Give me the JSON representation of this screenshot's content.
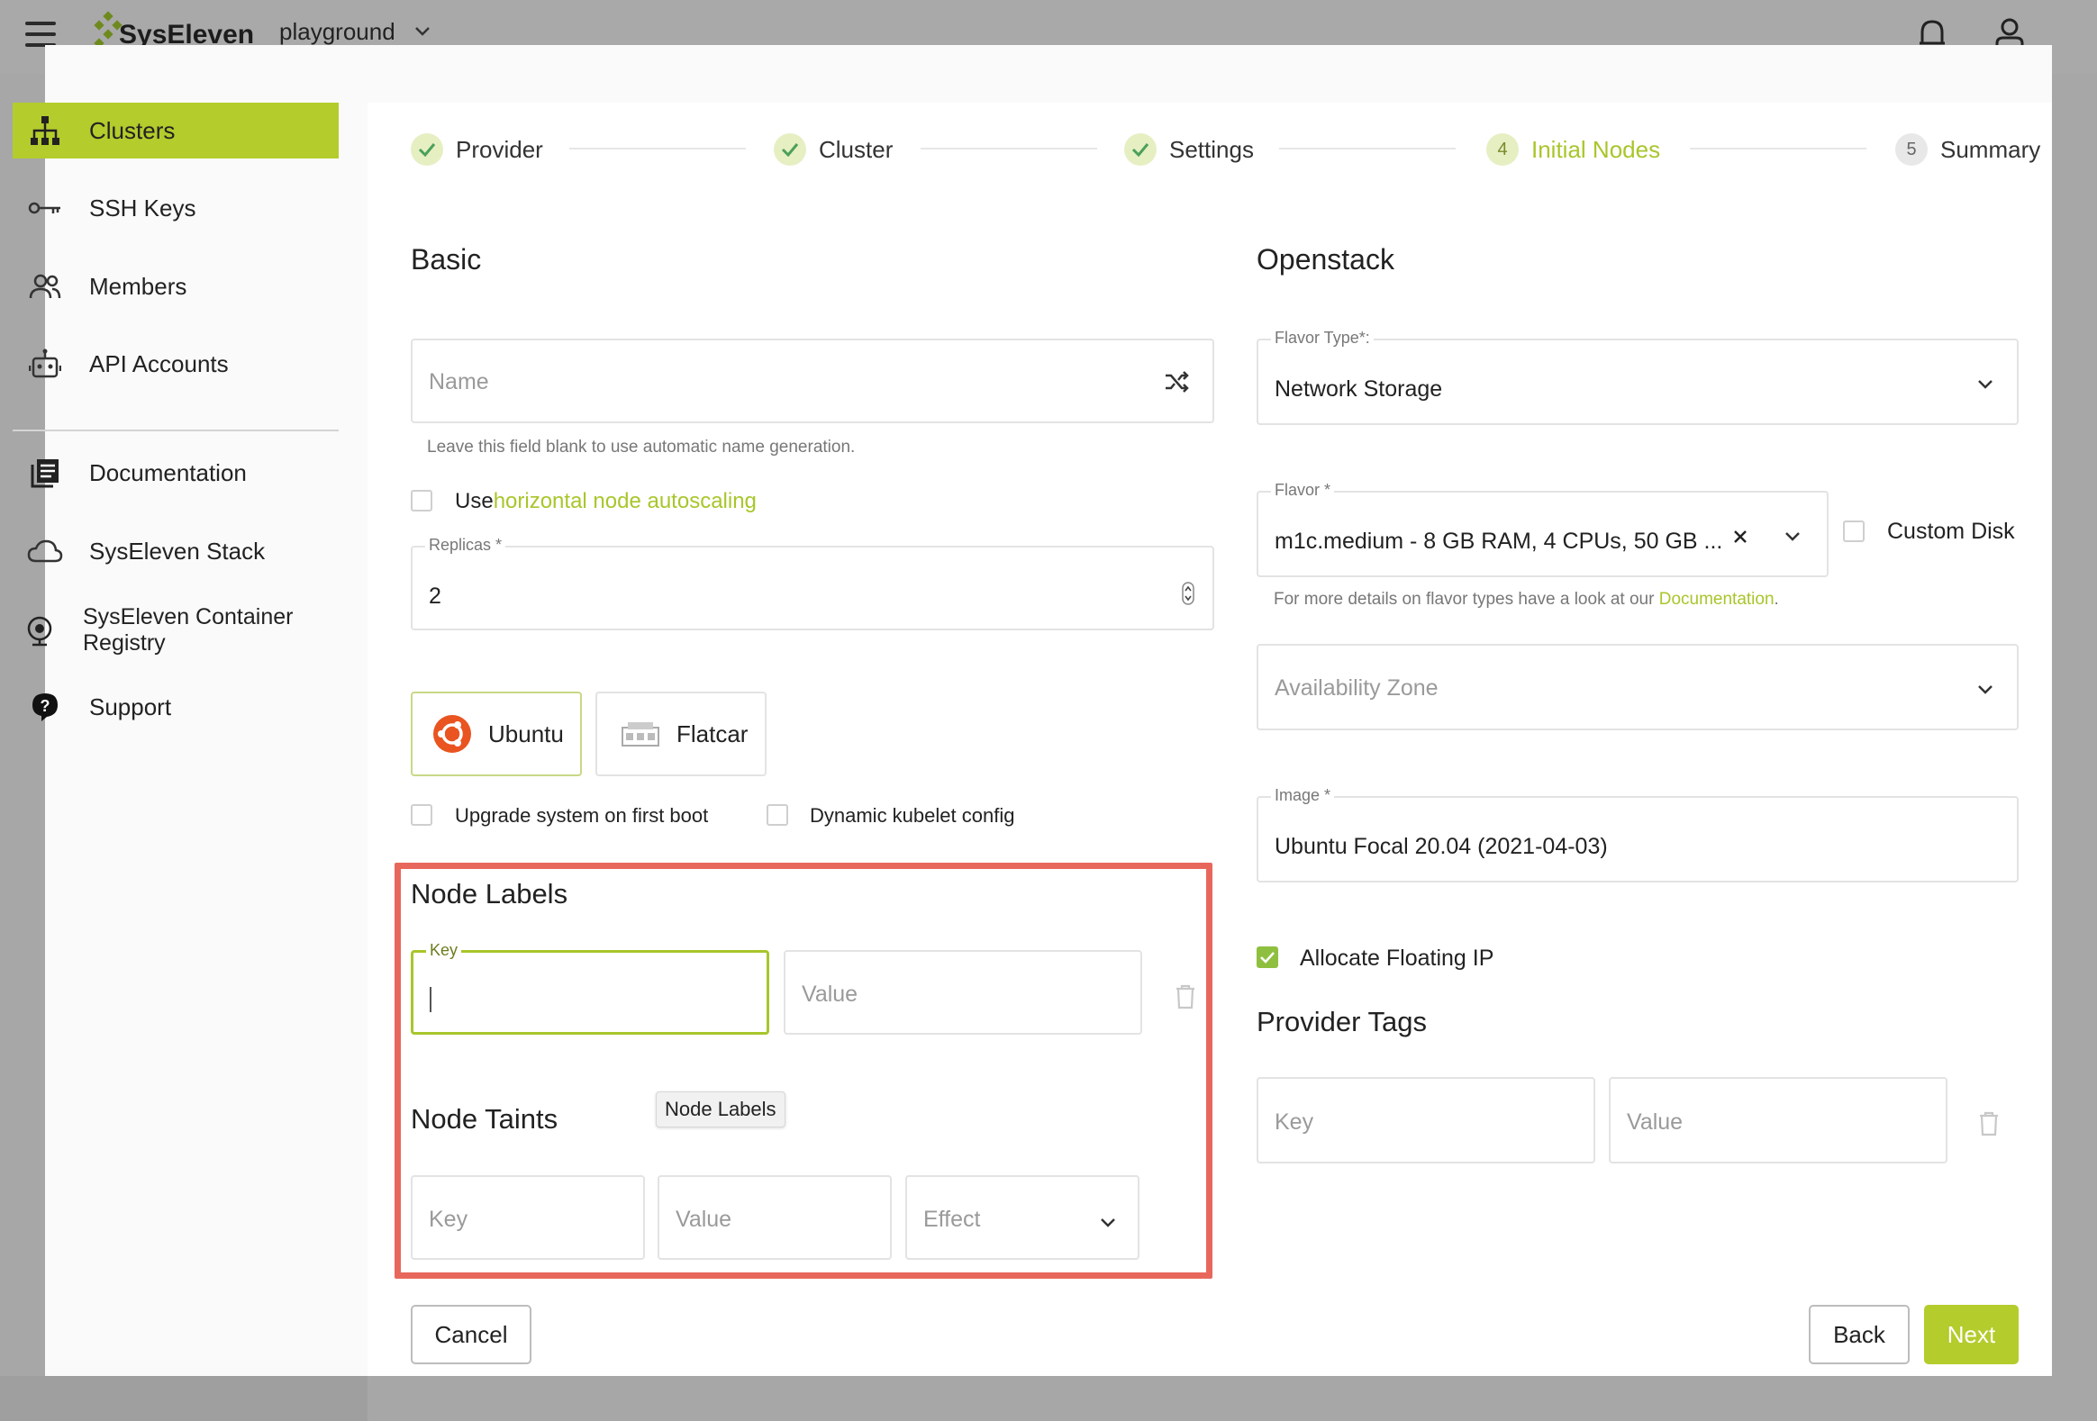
{
  "topbar": {
    "brand": "SysEleven",
    "project": "playground"
  },
  "sidebar": {
    "items": [
      {
        "label": "Clusters",
        "icon": "sitemap-icon",
        "active": true
      },
      {
        "label": "SSH Keys",
        "icon": "key-icon"
      },
      {
        "label": "Members",
        "icon": "members-icon"
      },
      {
        "label": "API Accounts",
        "icon": "robot-icon"
      },
      {
        "label": "Documentation",
        "icon": "documentation-icon"
      },
      {
        "label": "SysEleven Stack",
        "icon": "cloud-icon"
      },
      {
        "label": "SysEleven Container Registry",
        "icon": "registry-icon"
      },
      {
        "label": "Support",
        "icon": "help-icon"
      }
    ]
  },
  "stepper": {
    "steps": [
      {
        "label": "Provider",
        "state": "done"
      },
      {
        "label": "Cluster",
        "state": "done"
      },
      {
        "label": "Settings",
        "state": "done"
      },
      {
        "label": "Initial Nodes",
        "number": "4",
        "state": "current"
      },
      {
        "label": "Summary",
        "number": "5",
        "state": "pending"
      }
    ]
  },
  "basic": {
    "title": "Basic",
    "name_placeholder": "Name",
    "name_hint": "Leave this field blank to use automatic name generation.",
    "autoscaling_prefix": "Use",
    "autoscaling_link": "horizontal node autoscaling",
    "replicas_label": "Replicas *",
    "replicas_value": "2",
    "os_ubuntu": "Ubuntu",
    "os_flatcar": "Flatcar",
    "upgrade_label": "Upgrade system on first boot",
    "kubelet_label": "Dynamic kubelet config"
  },
  "node_labels": {
    "title": "Node Labels",
    "key_label": "Key",
    "value_placeholder": "Value",
    "tooltip": "Node Labels"
  },
  "node_taints": {
    "title": "Node Taints",
    "key_placeholder": "Key",
    "value_placeholder": "Value",
    "effect_placeholder": "Effect"
  },
  "openstack": {
    "title": "Openstack",
    "flavor_type_label": "Flavor Type*:",
    "flavor_type_value": "Network Storage",
    "flavor_label": "Flavor *",
    "flavor_value": "m1c.medium - 8 GB RAM, 4 CPUs, 50 GB ...",
    "custom_disk": "Custom Disk",
    "flavor_hint_prefix": "For more details on flavor types have a look at our ",
    "flavor_hint_link": "Documentation",
    "flavor_hint_suffix": ".",
    "az_placeholder": "Availability Zone",
    "image_label": "Image *",
    "image_value": "Ubuntu Focal 20.04 (2021-04-03)",
    "floating_ip": "Allocate Floating IP",
    "floating_ip_checked": true
  },
  "provider_tags": {
    "title": "Provider Tags",
    "key_placeholder": "Key",
    "value_placeholder": "Value"
  },
  "actions": {
    "cancel": "Cancel",
    "back": "Back",
    "next": "Next"
  },
  "colors": {
    "accent": "#b4cc2c",
    "highlight": "#e8675c"
  }
}
